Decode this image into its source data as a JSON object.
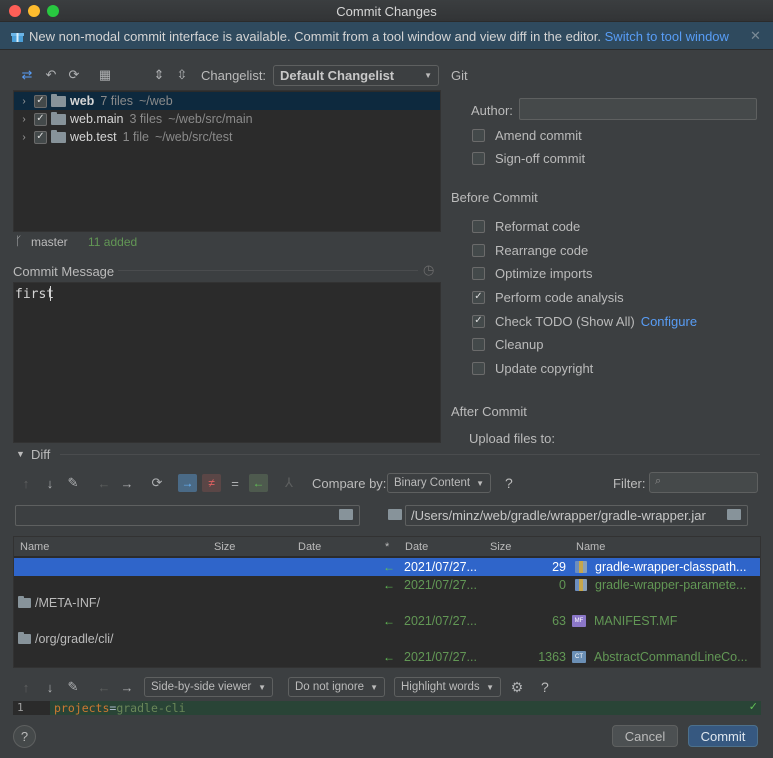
{
  "window": {
    "title": "Commit Changes"
  },
  "banner": {
    "text": "New non-modal commit interface is available. Commit from a tool window and view diff in the editor.",
    "link": "Switch to tool window",
    "close_icon": "close-icon"
  },
  "changes": {
    "changelist_label": "Changelist:",
    "changelist_value": "Default Changelist",
    "modules": [
      {
        "name": "web",
        "count": "7 files",
        "path": "~/web",
        "checked": true,
        "selected": true
      },
      {
        "name": "web.main",
        "count": "3 files",
        "path": "~/web/src/main",
        "checked": true,
        "selected": false
      },
      {
        "name": "web.test",
        "count": "1 file",
        "path": "~/web/src/test",
        "checked": true,
        "selected": false
      }
    ],
    "branch": "master",
    "added": "11 added"
  },
  "commit_message": {
    "label": "Commit Message",
    "value": "first"
  },
  "git": {
    "section": "Git",
    "author_label": "Author:",
    "author_value": "",
    "amend": "Amend commit",
    "signoff": "Sign-off commit"
  },
  "before_commit": {
    "section": "Before Commit",
    "options": [
      {
        "label": "Reformat code",
        "checked": false
      },
      {
        "label": "Rearrange code",
        "checked": false
      },
      {
        "label": "Optimize imports",
        "checked": false
      },
      {
        "label": "Perform code analysis",
        "checked": true
      },
      {
        "label": "Check TODO (Show All)",
        "checked": true,
        "link": "Configure"
      },
      {
        "label": "Cleanup",
        "checked": false
      },
      {
        "label": "Update copyright",
        "checked": false
      }
    ]
  },
  "after_commit": {
    "section": "After Commit",
    "upload_label": "Upload files to:"
  },
  "diff": {
    "label": "Diff",
    "compare_by_label": "Compare by:",
    "compare_by_value": "Binary Content",
    "help": "?",
    "filter_label": "Filter:",
    "left_path": "",
    "right_path": "/Users/minz/web/gradle/wrapper/gradle-wrapper.jar",
    "columns_left": [
      "Name",
      "Size",
      "Date"
    ],
    "columns_right": [
      "*",
      "Date",
      "Size",
      "Name"
    ],
    "rows": [
      {
        "folder": "",
        "date": "2021/07/27...",
        "size": "29",
        "name": "gradle-wrapper-classpath...",
        "selected": true
      },
      {
        "folder": "",
        "date": "2021/07/27...",
        "size": "0",
        "name": "gradle-wrapper-paramete...",
        "selected": false
      },
      {
        "folder": "/META-INF/",
        "date": "2021/07/27...",
        "size": "63",
        "name": "MANIFEST.MF",
        "selected": false
      },
      {
        "folder": "/org/gradle/cli/",
        "date": "2021/07/27...",
        "size": "1363",
        "name": "AbstractCommandLineCo...",
        "selected": false
      }
    ],
    "viewer": "Side-by-side viewer",
    "ignore": "Do not ignore",
    "highlight": "Highlight words",
    "help2": "?",
    "line_number": "1",
    "line_key": "projects",
    "line_eq": "=",
    "line_value": "gradle-cli"
  },
  "footer": {
    "help": "?",
    "cancel": "Cancel",
    "commit": "Commit"
  },
  "colors": {
    "accent": "#365880",
    "selection": "#2f65ca",
    "link": "#589df6",
    "added": "#629755"
  }
}
